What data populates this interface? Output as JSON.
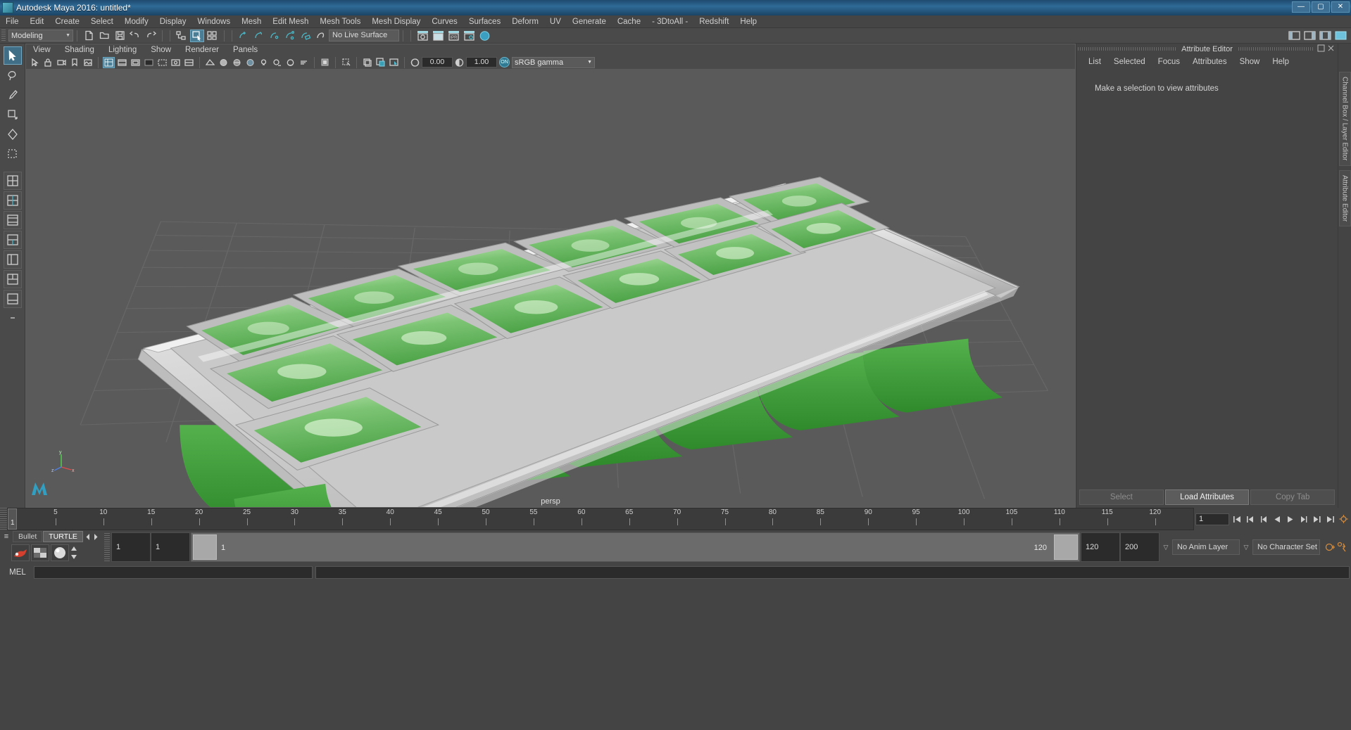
{
  "window": {
    "title": "Autodesk Maya 2016: untitled*",
    "controls": [
      "—",
      "▢",
      "✕"
    ]
  },
  "menubar": {
    "items": [
      "File",
      "Edit",
      "Create",
      "Select",
      "Modify",
      "Display",
      "Windows",
      "Mesh",
      "Edit Mesh",
      "Mesh Tools",
      "Mesh Display",
      "Curves",
      "Surfaces",
      "Deform",
      "UV",
      "Generate",
      "Cache",
      "- 3DtoAll -",
      "Redshift",
      "Help"
    ]
  },
  "statusline": {
    "mode": "Modeling",
    "mode_arrow": "▼",
    "live_surface": "No Live Surface"
  },
  "viewport_panel": {
    "menus": [
      "View",
      "Shading",
      "Lighting",
      "Show",
      "Renderer",
      "Panels"
    ],
    "exposure": "0.00",
    "gamma": "1.00",
    "color_profile": "sRGB gamma",
    "color_profile_arrow": "▼",
    "on_badge": "ON",
    "camera_label": "persp",
    "axis_labels": {
      "y": "y",
      "x": "x",
      "z": "z"
    }
  },
  "attribute_editor": {
    "title": "Attribute Editor",
    "menus": [
      "List",
      "Selected",
      "Focus",
      "Attributes",
      "Show",
      "Help"
    ],
    "empty_message": "Make a selection to view attributes",
    "buttons": [
      {
        "label": "Select",
        "primary": false
      },
      {
        "label": "Load Attributes",
        "primary": true
      },
      {
        "label": "Copy Tab",
        "primary": false
      }
    ]
  },
  "edge_tabs": [
    "Channel Box / Layer Editor",
    "Attribute Editor"
  ],
  "time_slider": {
    "current_frame": "1",
    "ticks": [
      {
        "label": "5",
        "pos": 5
      },
      {
        "label": "10",
        "pos": 10
      },
      {
        "label": "15",
        "pos": 15
      },
      {
        "label": "20",
        "pos": 20
      },
      {
        "label": "25",
        "pos": 25
      },
      {
        "label": "30",
        "pos": 30
      },
      {
        "label": "35",
        "pos": 35
      },
      {
        "label": "40",
        "pos": 40
      },
      {
        "label": "45",
        "pos": 45
      },
      {
        "label": "50",
        "pos": 50
      },
      {
        "label": "55",
        "pos": 55
      },
      {
        "label": "60",
        "pos": 60
      },
      {
        "label": "65",
        "pos": 65
      },
      {
        "label": "70",
        "pos": 70
      },
      {
        "label": "75",
        "pos": 75
      },
      {
        "label": "80",
        "pos": 80
      },
      {
        "label": "85",
        "pos": 85
      },
      {
        "label": "90",
        "pos": 90
      },
      {
        "label": "95",
        "pos": 95
      },
      {
        "label": "100",
        "pos": 100
      },
      {
        "label": "105",
        "pos": 105
      },
      {
        "label": "110",
        "pos": 110
      },
      {
        "label": "115",
        "pos": 115
      },
      {
        "label": "120",
        "pos": 120
      }
    ],
    "frame_field": "1"
  },
  "range_slider": {
    "layer_tabs": [
      {
        "label": "Bullet",
        "active": false
      },
      {
        "label": "TURTLE",
        "active": true
      }
    ],
    "anim_start": "1",
    "anim_start2": "1",
    "range_start_label": "1",
    "range_end_label": "120",
    "playback_end": "120",
    "anim_end": "200",
    "anim_layer": "No Anim Layer",
    "character_set": "No Character Set",
    "dropdown_arrow": "▽"
  },
  "command_line": {
    "language": "MEL",
    "input_value": "",
    "output_value": ""
  },
  "scene": {
    "object": "ice cube tray",
    "tray_color": "#d8d8d8",
    "cube_color": "#5fb85f",
    "ground_color": "#5a5a5a"
  }
}
